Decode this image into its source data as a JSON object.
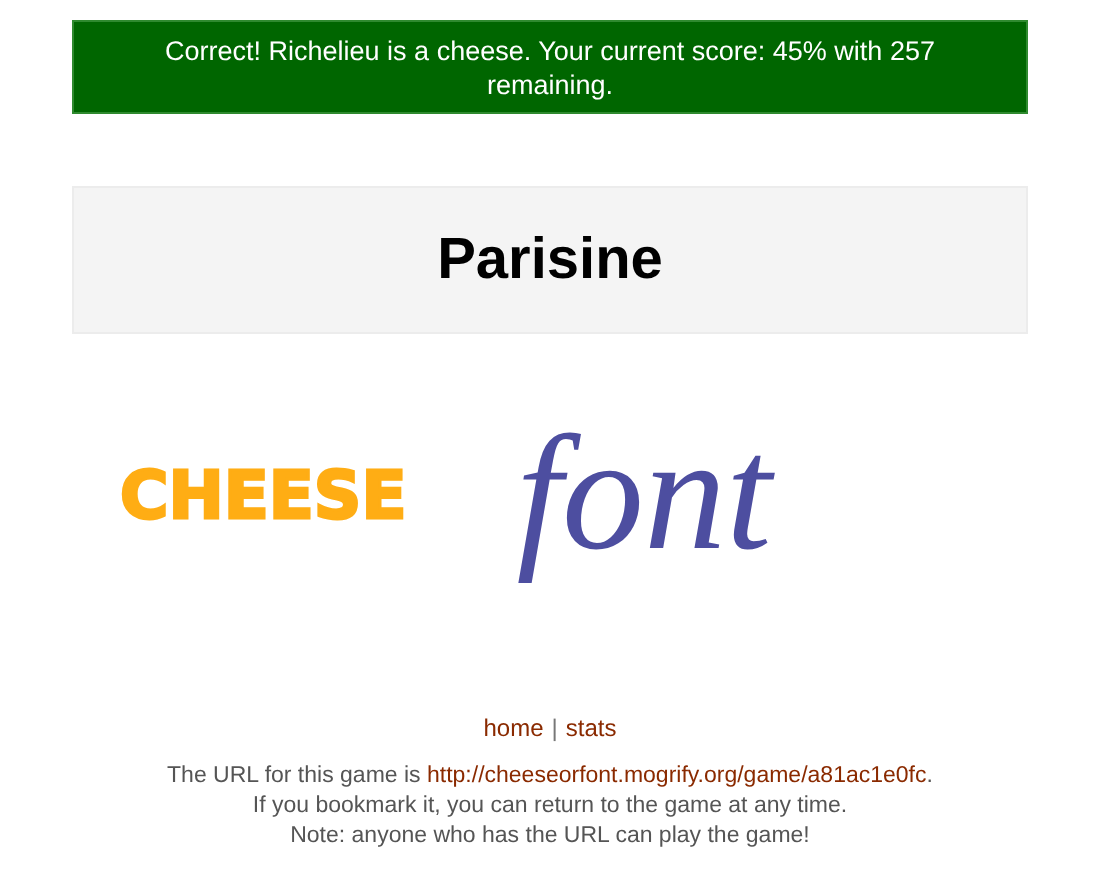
{
  "feedback": {
    "kind": "correct",
    "message": "Correct! Richelieu is a cheese. Your current score: 45% with 257 remaining."
  },
  "word": "Parisine",
  "choices": [
    {
      "kind": "cheese",
      "label": "CHEESE"
    },
    {
      "kind": "font",
      "label": "font"
    }
  ],
  "nav_links": [
    "home",
    "stats"
  ],
  "nav_separator": "|",
  "game_url": {
    "before": "The URL for this game is ",
    "link": "http://cheeseorfont.mogrify.org/game/a81ac1e0fc",
    "after": "."
  },
  "notes": [
    "If you bookmark it, you can return to the game at any time.",
    "Note: anyone who has the URL can play the game!"
  ]
}
